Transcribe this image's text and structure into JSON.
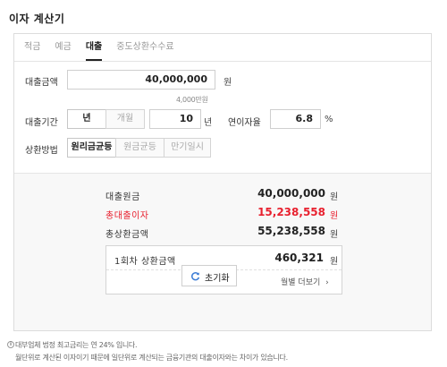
{
  "title": "이자 계산기",
  "tabs": [
    {
      "label": "적금"
    },
    {
      "label": "예금"
    },
    {
      "label": "대출"
    },
    {
      "label": "중도상환수수료"
    }
  ],
  "loan_amount": {
    "label": "대출금액",
    "value": "40,000,000",
    "unit": "원",
    "hint": "4,000만원"
  },
  "loan_period": {
    "label": "대출기간",
    "unit_options": [
      "년",
      "개월"
    ],
    "selected_unit": "년",
    "value": "10",
    "unit": "년"
  },
  "interest_rate": {
    "label": "연이자율",
    "value": "6.8",
    "unit": "%"
  },
  "repayment": {
    "label": "상환방법",
    "options": [
      "원리금균등",
      "원금균등",
      "만기일시"
    ],
    "selected": "원리금균등"
  },
  "results": {
    "principal": {
      "label": "대출원금",
      "value": "40,000,000",
      "unit": "원"
    },
    "total_interest": {
      "label": "총대출이자",
      "value": "15,238,558",
      "unit": "원"
    },
    "total_repayment": {
      "label": "총상환금액",
      "value": "55,238,558",
      "unit": "원"
    },
    "first_payment": {
      "label": "1회차 상환금액",
      "value": "460,321",
      "unit": "원"
    },
    "monthly_more": "월별 더보기"
  },
  "reset_label": "초기화",
  "notes": [
    "대부업체 법정 최고금리는 연 24% 입니다.",
    "월단위로 계산된 이자이기 때문에 일단위로 계산되는 금융기관의 대출이자와는 차이가 있습니다."
  ],
  "colors": {
    "accent_red": "#e8212f",
    "refresh_blue": "#3a7bd5"
  }
}
